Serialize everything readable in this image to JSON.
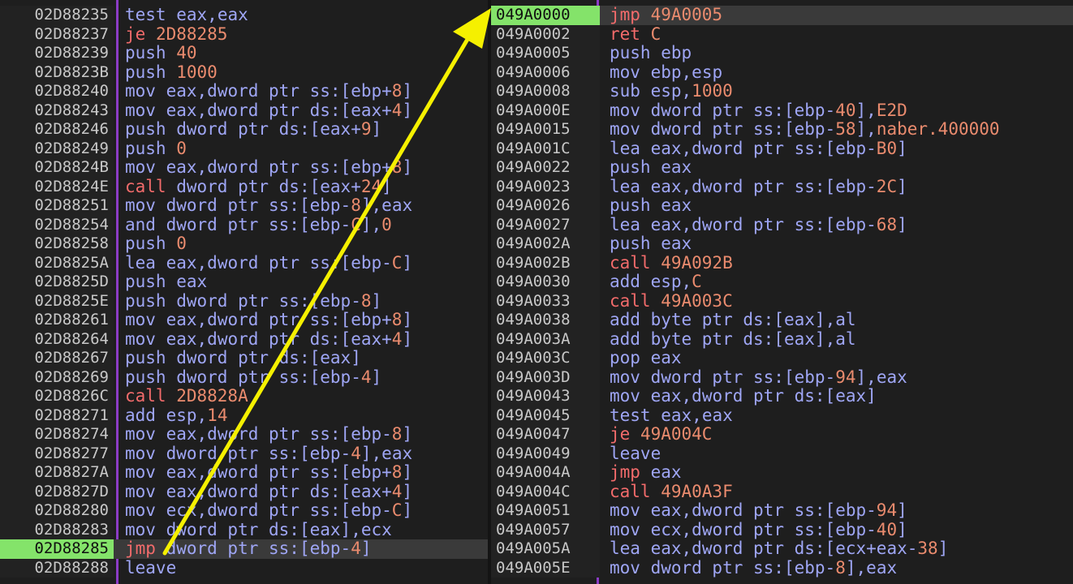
{
  "left": {
    "addresses": [
      "02D88235",
      "02D88237",
      "02D88239",
      "02D8823B",
      "02D88240",
      "02D88243",
      "02D88246",
      "02D88249",
      "02D8824B",
      "02D8824E",
      "02D88251",
      "02D88254",
      "02D88258",
      "02D8825A",
      "02D8825D",
      "02D8825E",
      "02D88261",
      "02D88264",
      "02D88267",
      "02D88269",
      "02D8826C",
      "02D88271",
      "02D88274",
      "02D88277",
      "02D8827A",
      "02D8827D",
      "02D88280",
      "02D88283",
      "02D88285",
      "02D88288"
    ],
    "instructions": [
      "test eax,eax",
      "je 2D88285",
      "push 40",
      "push 1000",
      "mov eax,dword ptr ss:[ebp+8]",
      "mov eax,dword ptr ds:[eax+4]",
      "push dword ptr ds:[eax+9]",
      "push 0",
      "mov eax,dword ptr ss:[ebp+8]",
      "call dword ptr ds:[eax+24]",
      "mov dword ptr ss:[ebp-8],eax",
      "and dword ptr ss:[ebp-C],0",
      "push 0",
      "lea eax,dword ptr ss:[ebp-C]",
      "push eax",
      "push dword ptr ss:[ebp-8]",
      "mov eax,dword ptr ss:[ebp+8]",
      "mov eax,dword ptr ds:[eax+4]",
      "push dword ptr ds:[eax]",
      "push dword ptr ss:[ebp-4]",
      "call 2D8828A",
      "add esp,14",
      "mov eax,dword ptr ss:[ebp-8]",
      "mov dword ptr ss:[ebp-4],eax",
      "mov eax,dword ptr ss:[ebp+8]",
      "mov eax,dword ptr ds:[eax+4]",
      "mov ecx,dword ptr ss:[ebp-C]",
      "mov dword ptr ds:[eax],ecx",
      "jmp dword ptr ss:[ebp-4]",
      "leave"
    ],
    "selected_index": 28
  },
  "right": {
    "addresses": [
      "049A0000",
      "049A0002",
      "049A0005",
      "049A0006",
      "049A0008",
      "049A000E",
      "049A0015",
      "049A001C",
      "049A0022",
      "049A0023",
      "049A0026",
      "049A0027",
      "049A002A",
      "049A002B",
      "049A0030",
      "049A0033",
      "049A0038",
      "049A003A",
      "049A003C",
      "049A003D",
      "049A0043",
      "049A0045",
      "049A0047",
      "049A0049",
      "049A004A",
      "049A004C",
      "049A0051",
      "049A0057",
      "049A005A",
      "049A005E"
    ],
    "instructions": [
      "jmp 49A0005",
      "ret C",
      "push ebp",
      "mov ebp,esp",
      "sub esp,1000",
      "mov dword ptr ss:[ebp-40],E2D",
      "mov dword ptr ss:[ebp-58],naber.400000",
      "lea eax,dword ptr ss:[ebp-B0]",
      "push eax",
      "lea eax,dword ptr ss:[ebp-2C]",
      "push eax",
      "lea eax,dword ptr ss:[ebp-68]",
      "push eax",
      "call 49A092B",
      "add esp,C",
      "call 49A003C",
      "add byte ptr ds:[eax],al",
      "add byte ptr ds:[eax],al",
      "pop eax",
      "mov dword ptr ss:[ebp-94],eax",
      "mov eax,dword ptr ds:[eax]",
      "test eax,eax",
      "je 49A004C",
      "leave",
      "jmp eax",
      "call 49A0A3F",
      "mov eax,dword ptr ss:[ebp-94]",
      "mov ecx,dword ptr ss:[ebp-40]",
      "lea eax,dword ptr ds:[ecx+eax-38]",
      "mov dword ptr ss:[ebp-8],eax"
    ],
    "selected_index": 0
  },
  "colors": {
    "background": "#1e1e1e",
    "address_selected": "#84e36a",
    "separator": "#8c3cc6",
    "arrow": "#f5f000",
    "number": "#ea8b6e",
    "jump_call": "#f26b6b"
  }
}
